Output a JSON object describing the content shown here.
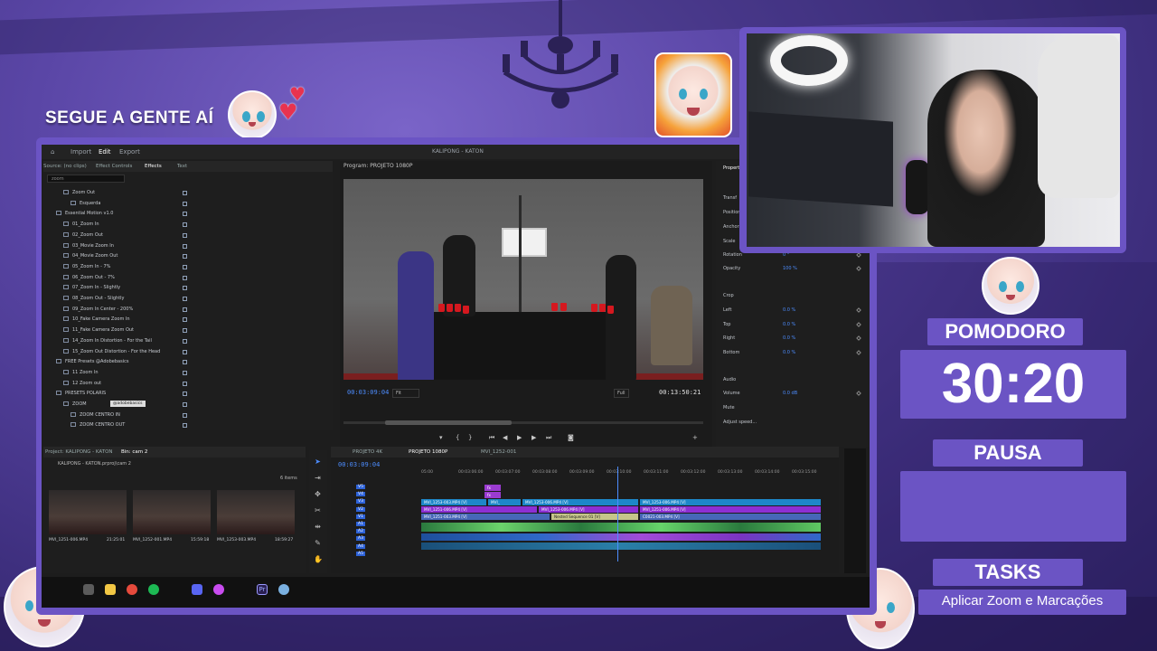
{
  "overlay": {
    "follow_text": "SEGUE A GENTE AÍ",
    "pomodoro_label": "POMODORO",
    "timer": "30:20",
    "pause_label": "PAUSA",
    "tasks_label": "TASKS",
    "current_task": "Aplicar Zoom e Marcações",
    "accent_color": "#6b54c4"
  },
  "app": {
    "menu": {
      "home_icon": "home-icon",
      "import": "Import",
      "edit": "Edit",
      "export": "Export"
    },
    "title": "KALIPONG - KATON",
    "effects_panel": {
      "tabs": [
        "Source: (no clips)",
        "Effect Controls",
        "Effects",
        "Text"
      ],
      "search_value": "zoom",
      "items": [
        {
          "label": "Zoom Out",
          "indent": 2
        },
        {
          "label": "Esquerda",
          "indent": 3
        },
        {
          "label": "Essential Motion v1.0",
          "indent": 1
        },
        {
          "label": "01_Zoom In",
          "indent": 2
        },
        {
          "label": "02_Zoom Out",
          "indent": 2
        },
        {
          "label": "03_Movie Zoom In",
          "indent": 2
        },
        {
          "label": "04_Movie Zoom Out",
          "indent": 2
        },
        {
          "label": "05_Zoom In - 7%",
          "indent": 2
        },
        {
          "label": "06_Zoom Out - 7%",
          "indent": 2
        },
        {
          "label": "07_Zoom In - Slightly",
          "indent": 2
        },
        {
          "label": "08_Zoom Out - Slightly",
          "indent": 2
        },
        {
          "label": "09_Zoom In Center - 200%",
          "indent": 2
        },
        {
          "label": "10_Fake Camera Zoom In",
          "indent": 2
        },
        {
          "label": "11_Fake Camera Zoom Out",
          "indent": 2
        },
        {
          "label": "14_Zoom In Distortion - For the Tail",
          "indent": 2
        },
        {
          "label": "15_Zoom Out Distortion - For the Head",
          "indent": 2
        },
        {
          "label": "FREE Presets @Adobebasics",
          "indent": 1
        },
        {
          "label": "11 Zoom In",
          "indent": 2
        },
        {
          "label": "12 Zoom out",
          "indent": 2
        },
        {
          "label": "PRESETS POLARIS",
          "indent": 1
        },
        {
          "label": "ZOOM",
          "indent": 2
        },
        {
          "label": "ZOOM CENTRO IN",
          "indent": 3
        },
        {
          "label": "ZOOM CENTRO OUT",
          "indent": 3
        }
      ],
      "tooltip": "@adobebasics"
    },
    "program_monitor": {
      "title": "Program: PROJETO 1080P",
      "timecode": "00:03:09:04",
      "fit": "Fit",
      "resolution": "Full",
      "duration": "00:13:50:21"
    },
    "properties": {
      "tab": "Properties",
      "rows": [
        {
          "label": "Transf",
          "value": ""
        },
        {
          "label": "Position",
          "value": ""
        },
        {
          "label": "Anchor",
          "value": ""
        },
        {
          "label": "Scale",
          "value": "100 %"
        },
        {
          "label": "Rotation",
          "value": "0 °"
        },
        {
          "label": "Opacity",
          "value": "100 %"
        },
        {
          "label": "Crop",
          "value": ""
        },
        {
          "label": "Left",
          "value": "0.0 %"
        },
        {
          "label": "Top",
          "value": "0.0 %"
        },
        {
          "label": "Right",
          "value": "0.0 %"
        },
        {
          "label": "Bottom",
          "value": "0.0 %"
        },
        {
          "label": "Audio",
          "value": ""
        },
        {
          "label": "Volume",
          "value": "0.0 dB"
        },
        {
          "label": "Mute",
          "value": ""
        },
        {
          "label": "Adjust speed...",
          "value": ""
        }
      ]
    },
    "project": {
      "tabs": [
        "Project: KALIPONG - KATON",
        "Bin: cam 2"
      ],
      "path": "KALIPONG - KATON.prproj\\cam 2",
      "count": "6 items",
      "clips": [
        {
          "name": "MVI_1251-006.MP4",
          "duration": "21:25:01"
        },
        {
          "name": "MVI_1252-001.MP4",
          "duration": "15:59:18"
        },
        {
          "name": "MVI_1253-003.MP4",
          "duration": "18:59:27"
        }
      ]
    },
    "timeline": {
      "tabs": [
        "PROJETO 4K",
        "PROJETO 1080P",
        "MVI_1252-001"
      ],
      "timecode": "00:03:09:04",
      "ruler": [
        "05:00",
        "00:03:06:00",
        "00:03:07:00",
        "00:03:08:00",
        "00:03:09:00",
        "00:03:10:00",
        "00:03:11:00",
        "00:03:12:00",
        "00:03:13:00",
        "00:03:14:00",
        "00:03:15:00"
      ],
      "video_tracks": [
        "V5",
        "V4",
        "V3",
        "V2",
        "V1"
      ],
      "audio_tracks": [
        "A1",
        "A2",
        "A3",
        "A4",
        "A5"
      ],
      "clips": {
        "c1": "MVI_1253-003.MP4 [V]",
        "c2": "MVI_",
        "c3": "MVI_1253-006.MP4 [V]",
        "c4": "MVI_1253-006.MP4 [V]",
        "c5": "MVI_1251-006.MP4 [V]",
        "c6": "MVI_1253-006.MP4 [V]",
        "c7": "MVI_1251-006.MP4 [V]",
        "c8": "MVI_1251-003.MP4 [V]",
        "c9": "Nested Sequence 01 [V]",
        "c10": "C0021-003.MP4 [V]",
        "fx": "fx"
      }
    }
  }
}
